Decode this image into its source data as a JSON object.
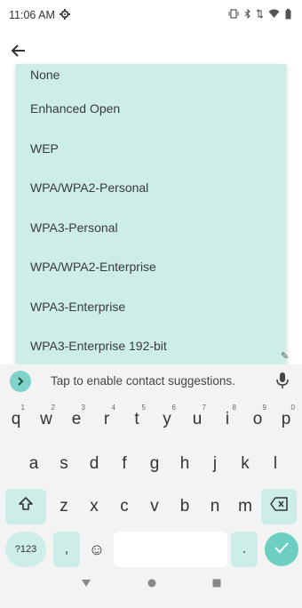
{
  "status_bar": {
    "time": "11:06 AM",
    "settings_icon": "gear-icon",
    "right_icons": [
      "vibrate-icon",
      "bluetooth-icon",
      "data-icon",
      "wifi-icon",
      "battery-icon"
    ]
  },
  "header": {
    "back_icon": "back-arrow-icon"
  },
  "dropdown": {
    "items": [
      {
        "label": "None"
      },
      {
        "label": "Enhanced Open"
      },
      {
        "label": "WEP"
      },
      {
        "label": "WPA/WPA2-Personal"
      },
      {
        "label": "WPA3-Personal"
      },
      {
        "label": "WPA/WPA2-Enterprise"
      },
      {
        "label": "WPA3-Enterprise"
      },
      {
        "label": "WPA3-Enterprise 192-bit"
      }
    ]
  },
  "keyboard": {
    "suggestion_text": "Tap to enable contact suggestions.",
    "row1": [
      {
        "key": "q",
        "hint": "1"
      },
      {
        "key": "w",
        "hint": "2"
      },
      {
        "key": "e",
        "hint": "3"
      },
      {
        "key": "r",
        "hint": "4"
      },
      {
        "key": "t",
        "hint": "5"
      },
      {
        "key": "y",
        "hint": "6"
      },
      {
        "key": "u",
        "hint": "7"
      },
      {
        "key": "i",
        "hint": "8"
      },
      {
        "key": "o",
        "hint": "9"
      },
      {
        "key": "p",
        "hint": "0"
      }
    ],
    "row2": [
      "a",
      "s",
      "d",
      "f",
      "g",
      "h",
      "j",
      "k",
      "l"
    ],
    "row3": [
      "z",
      "x",
      "c",
      "v",
      "b",
      "n",
      "m"
    ],
    "num_key": "?123",
    "comma_key": ",",
    "period_key": ".",
    "emoji": "☺"
  },
  "colors": {
    "accent": "#6ccfc2",
    "dropdown_bg": "#cdeee8"
  }
}
